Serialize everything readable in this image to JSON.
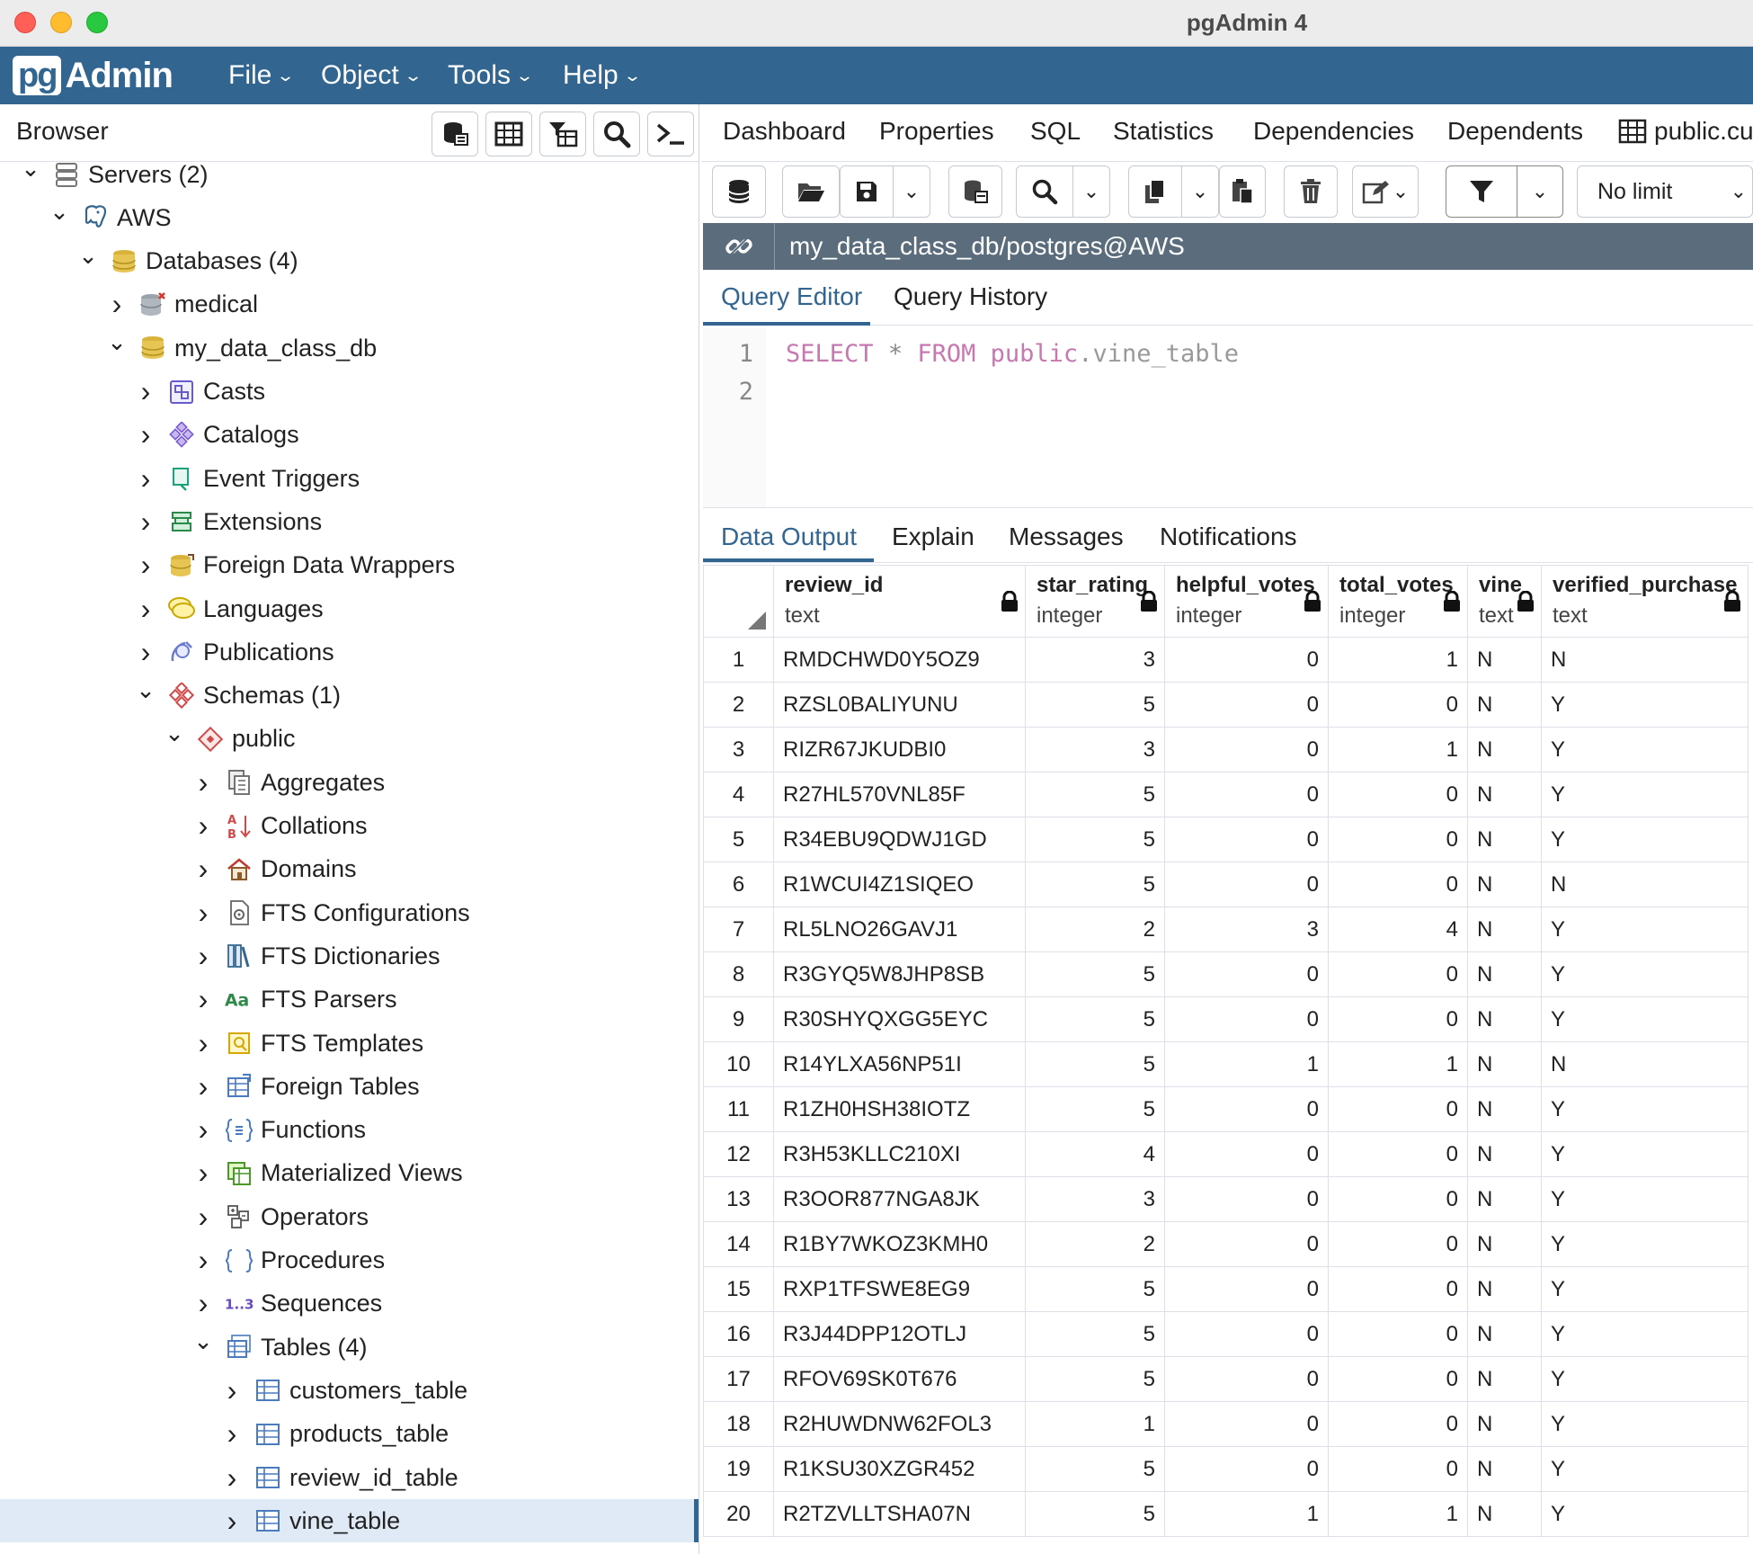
{
  "window": {
    "title": "pgAdmin 4"
  },
  "app": {
    "logo_pg": "pg",
    "logo_admin": "Admin",
    "brand_color": "#326690"
  },
  "menu": [
    {
      "label": "File"
    },
    {
      "label": "Object"
    },
    {
      "label": "Tools"
    },
    {
      "label": "Help"
    }
  ],
  "browser": {
    "title": "Browser",
    "tree": [
      {
        "label": "Servers (2)",
        "icon": "servers-icon",
        "expanded": true
      },
      {
        "label": "AWS",
        "icon": "postgres-elephant-icon",
        "expanded": true
      },
      {
        "label": "Databases (4)",
        "icon": "databases-icon",
        "expanded": true
      },
      {
        "label": "medical",
        "icon": "database-disconnected-icon",
        "expanded": false
      },
      {
        "label": "my_data_class_db",
        "icon": "database-icon",
        "expanded": true
      },
      {
        "label": "Casts",
        "icon": "casts-icon",
        "expanded": false
      },
      {
        "label": "Catalogs",
        "icon": "catalogs-icon",
        "expanded": false
      },
      {
        "label": "Event Triggers",
        "icon": "event-triggers-icon",
        "expanded": false
      },
      {
        "label": "Extensions",
        "icon": "extensions-icon",
        "expanded": false
      },
      {
        "label": "Foreign Data Wrappers",
        "icon": "fdw-icon",
        "expanded": false
      },
      {
        "label": "Languages",
        "icon": "languages-icon",
        "expanded": false
      },
      {
        "label": "Publications",
        "icon": "publications-icon",
        "expanded": false
      },
      {
        "label": "Schemas (1)",
        "icon": "schemas-icon",
        "expanded": true
      },
      {
        "label": "public",
        "icon": "schema-icon",
        "expanded": true
      },
      {
        "label": "Aggregates",
        "icon": "aggregates-icon",
        "expanded": false
      },
      {
        "label": "Collations",
        "icon": "collations-icon",
        "expanded": false
      },
      {
        "label": "Domains",
        "icon": "domains-icon",
        "expanded": false
      },
      {
        "label": "FTS Configurations",
        "icon": "fts-config-icon",
        "expanded": false
      },
      {
        "label": "FTS Dictionaries",
        "icon": "fts-dict-icon",
        "expanded": false
      },
      {
        "label": "FTS Parsers",
        "icon": "fts-parser-icon",
        "expanded": false
      },
      {
        "label": "FTS Templates",
        "icon": "fts-template-icon",
        "expanded": false
      },
      {
        "label": "Foreign Tables",
        "icon": "foreign-table-icon",
        "expanded": false
      },
      {
        "label": "Functions",
        "icon": "functions-icon",
        "expanded": false
      },
      {
        "label": "Materialized Views",
        "icon": "mview-icon",
        "expanded": false
      },
      {
        "label": "Operators",
        "icon": "operators-icon",
        "expanded": false
      },
      {
        "label": "Procedures",
        "icon": "procedures-icon",
        "expanded": false
      },
      {
        "label": "Sequences",
        "icon": "sequences-icon",
        "expanded": false
      },
      {
        "label": "Tables (4)",
        "icon": "tables-icon",
        "expanded": true
      },
      {
        "label": "customers_table",
        "icon": "table-icon",
        "expanded": false
      },
      {
        "label": "products_table",
        "icon": "table-icon",
        "expanded": false
      },
      {
        "label": "review_id_table",
        "icon": "table-icon",
        "expanded": false
      },
      {
        "label": "vine_table",
        "icon": "table-icon",
        "expanded": false,
        "selected": true
      }
    ]
  },
  "tabs": [
    {
      "label": "Dashboard"
    },
    {
      "label": "Properties"
    },
    {
      "label": "SQL"
    },
    {
      "label": "Statistics"
    },
    {
      "label": "Dependencies"
    },
    {
      "label": "Dependents"
    },
    {
      "label": "public.cu"
    }
  ],
  "query_tool": {
    "limit": "No limit",
    "connection": "my_data_class_db/postgres@AWS",
    "subtabs": [
      {
        "label": "Query Editor",
        "active": true
      },
      {
        "label": "Query History"
      }
    ],
    "editor": {
      "line_numbers": [
        "1",
        "2"
      ],
      "tokens": {
        "select": "SELECT",
        "star": "*",
        "from": "FROM",
        "schema": "public",
        "dot": ".",
        "table": "vine_table"
      }
    },
    "output_tabs": [
      {
        "label": "Data Output",
        "active": true
      },
      {
        "label": "Explain"
      },
      {
        "label": "Messages"
      },
      {
        "label": "Notifications"
      }
    ]
  },
  "results": {
    "columns": [
      {
        "name": "review_id",
        "type": "text"
      },
      {
        "name": "star_rating",
        "type": "integer"
      },
      {
        "name": "helpful_votes",
        "type": "integer"
      },
      {
        "name": "total_votes",
        "type": "integer"
      },
      {
        "name": "vine",
        "type": "text"
      },
      {
        "name": "verified_purchase",
        "type": "text"
      }
    ],
    "rows": [
      [
        "1",
        "RMDCHWD0Y5OZ9",
        "3",
        "0",
        "1",
        "N",
        "N"
      ],
      [
        "2",
        "RZSL0BALIYUNU",
        "5",
        "0",
        "0",
        "N",
        "Y"
      ],
      [
        "3",
        "RIZR67JKUDBI0",
        "3",
        "0",
        "1",
        "N",
        "Y"
      ],
      [
        "4",
        "R27HL570VNL85F",
        "5",
        "0",
        "0",
        "N",
        "Y"
      ],
      [
        "5",
        "R34EBU9QDWJ1GD",
        "5",
        "0",
        "0",
        "N",
        "Y"
      ],
      [
        "6",
        "R1WCUI4Z1SIQEO",
        "5",
        "0",
        "0",
        "N",
        "N"
      ],
      [
        "7",
        "RL5LNO26GAVJ1",
        "2",
        "3",
        "4",
        "N",
        "Y"
      ],
      [
        "8",
        "R3GYQ5W8JHP8SB",
        "5",
        "0",
        "0",
        "N",
        "Y"
      ],
      [
        "9",
        "R30SHYQXGG5EYC",
        "5",
        "0",
        "0",
        "N",
        "Y"
      ],
      [
        "10",
        "R14YLXA56NP51I",
        "5",
        "1",
        "1",
        "N",
        "N"
      ],
      [
        "11",
        "R1ZH0HSH38IOTZ",
        "5",
        "0",
        "0",
        "N",
        "Y"
      ],
      [
        "12",
        "R3H53KLLC210XI",
        "4",
        "0",
        "0",
        "N",
        "Y"
      ],
      [
        "13",
        "R3OOR877NGA8JK",
        "3",
        "0",
        "0",
        "N",
        "Y"
      ],
      [
        "14",
        "R1BY7WKOZ3KMH0",
        "2",
        "0",
        "0",
        "N",
        "Y"
      ],
      [
        "15",
        "RXP1TFSWE8EG9",
        "5",
        "0",
        "0",
        "N",
        "Y"
      ],
      [
        "16",
        "R3J44DPP12OTLJ",
        "5",
        "0",
        "0",
        "N",
        "Y"
      ],
      [
        "17",
        "RFOV69SK0T676",
        "5",
        "0",
        "0",
        "N",
        "Y"
      ],
      [
        "18",
        "R2HUWDNW62FOL3",
        "1",
        "0",
        "0",
        "N",
        "Y"
      ],
      [
        "19",
        "R1KSU30XZGR452",
        "5",
        "0",
        "0",
        "N",
        "Y"
      ],
      [
        "20",
        "R2TZVLLTSHA07N",
        "5",
        "1",
        "1",
        "N",
        "Y"
      ]
    ]
  }
}
